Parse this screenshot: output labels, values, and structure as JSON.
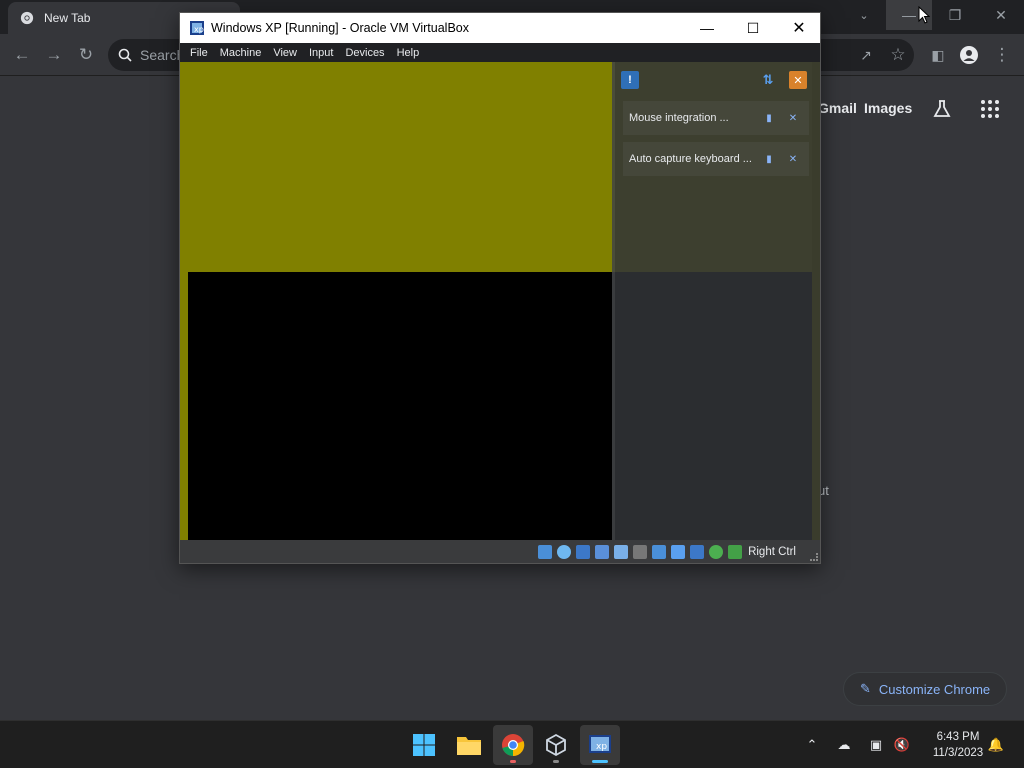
{
  "browser": {
    "tab_title": "New Tab",
    "omnibox_placeholder": "Search",
    "links": {
      "gmail": "Gmail",
      "images": "Images"
    },
    "fragment_text": "ut",
    "customize_label": "Customize Chrome"
  },
  "vbox": {
    "title": "Windows XP [Running] - Oracle VM VirtualBox",
    "menu": [
      "File",
      "Machine",
      "View",
      "Input",
      "Devices",
      "Help"
    ],
    "notifications": [
      {
        "text": "Mouse integration ..."
      },
      {
        "text": "Auto capture keyboard ..."
      }
    ],
    "host_key": "Right Ctrl"
  },
  "taskbar": {
    "time": "6:43 PM",
    "date": "11/3/2023"
  },
  "colors": {
    "vm_olive": "#808000",
    "chrome_bg": "#35363a",
    "accent_blue": "#8ab4f8"
  }
}
